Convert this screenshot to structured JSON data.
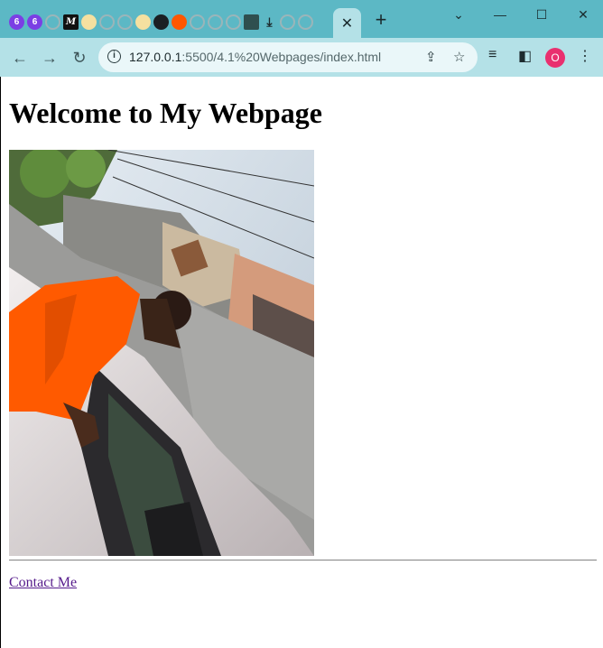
{
  "browser": {
    "active_tab_close": "✕",
    "new_tab_label": "+",
    "window_controls": [
      "⌄",
      "—",
      "☐",
      "✕"
    ],
    "url_host": "127.0.0.1",
    "url_rest": ":5500/4.1%20Webpages/index.html",
    "profile_initial": "O",
    "favicons": [
      "6",
      "6",
      "",
      "M",
      "",
      "",
      "",
      "",
      "",
      "",
      "",
      "",
      "",
      "",
      "",
      ""
    ]
  },
  "page": {
    "heading": "Welcome to My Webpage",
    "link_text": "Contact Me"
  },
  "colors": {
    "tabstrip": "#5cb8c5",
    "toolbar": "#b4e1e7",
    "link_visited": "#551a8b",
    "avatar": "#e9306f"
  }
}
